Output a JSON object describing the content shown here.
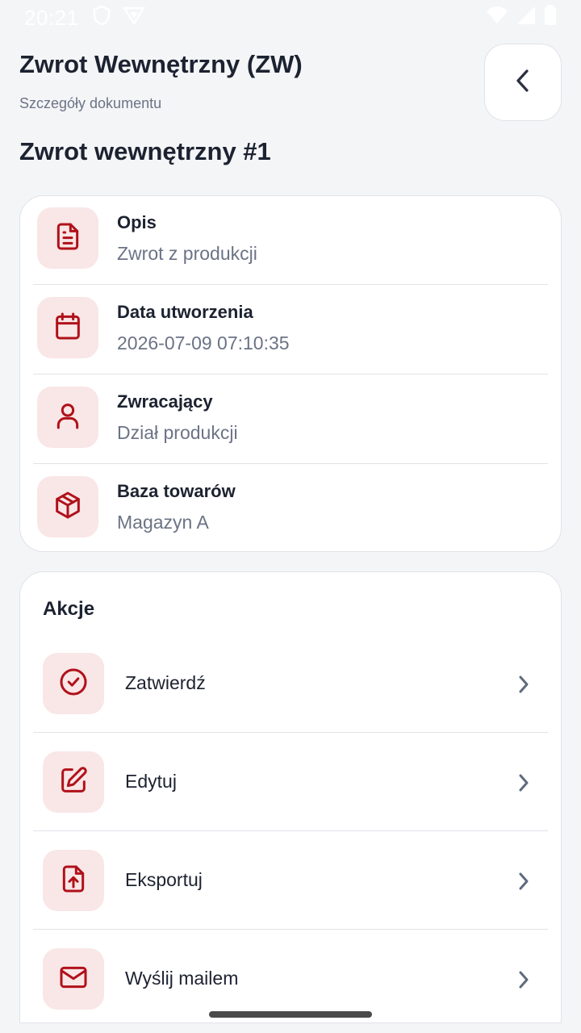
{
  "status_bar": {
    "time": "20:21",
    "left_icons": [
      "shield-icon",
      "vpn-icon"
    ],
    "right_icons": [
      "wifi-icon",
      "signal-icon",
      "battery-icon"
    ]
  },
  "header": {
    "title": "Zwrot Wewnętrzny (ZW)",
    "subtitle": "Szczegóły dokumentu"
  },
  "document_title": "Zwrot wewnętrzny #1",
  "accent_color": "#b0111a",
  "icon_bg_color": "#f9e6e6",
  "details": [
    {
      "icon": "document-icon",
      "label": "Opis",
      "value": "Zwrot z produkcji"
    },
    {
      "icon": "calendar-icon",
      "label": "Data utworzenia",
      "value": "2026-07-09 07:10:35"
    },
    {
      "icon": "user-icon",
      "label": "Zwracający",
      "value": "Dział produkcji"
    },
    {
      "icon": "package-icon",
      "label": "Baza towarów",
      "value": "Magazyn A"
    }
  ],
  "actions": {
    "title": "Akcje",
    "items": [
      {
        "icon": "check-circle-icon",
        "label": "Zatwierdź"
      },
      {
        "icon": "edit-icon",
        "label": "Edytuj"
      },
      {
        "icon": "file-upload-icon",
        "label": "Eksportuj"
      },
      {
        "icon": "mail-icon",
        "label": "Wyślij mailem"
      }
    ]
  }
}
